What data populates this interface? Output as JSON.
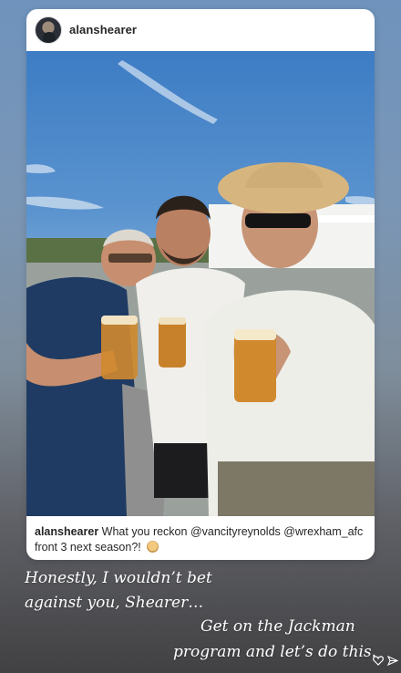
{
  "post": {
    "username": "alanshearer",
    "caption_user": "alanshearer",
    "caption_text": "What you reckon @vancityreynolds @wrexham_afc front 3 next season?!",
    "caption_emoji": "thinking-face-emoji"
  },
  "overlay_text": {
    "line1": "Honestly, I wouldn’t bet",
    "line2": "against you, Shearer…",
    "line3": "Get on the Jackman",
    "line4": "program and let’s do this."
  },
  "icons": [
    "heart-icon",
    "send-icon"
  ]
}
